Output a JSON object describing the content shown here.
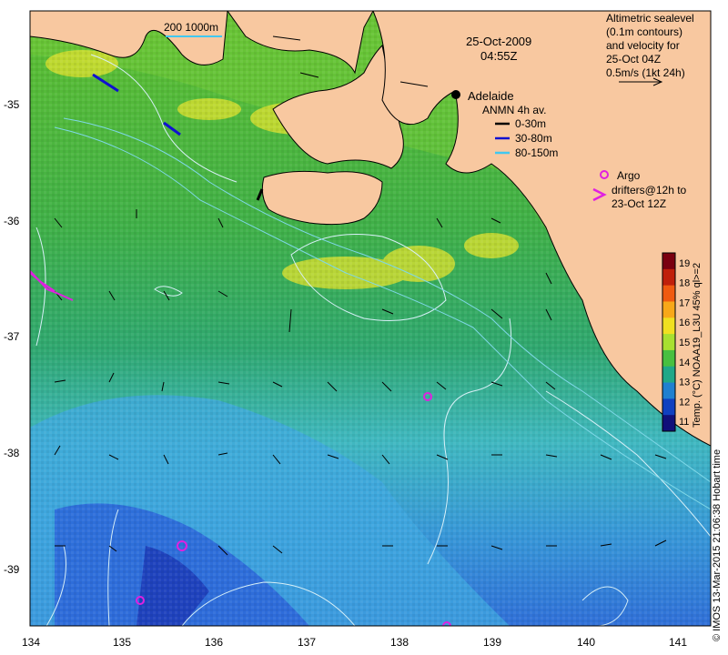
{
  "date_text": "25-Oct-2009",
  "time_text": "04:55Z",
  "scale_bar_label": "200  1000m",
  "city_label": "Adelaide",
  "altimetry_note": [
    "Altimetric sealevel",
    "(0.1m contours)",
    "and velocity for",
    "25-Oct 04Z",
    "0.5m/s (1kt 24h)"
  ],
  "anmn_legend": {
    "title": "ANMN 4h av.",
    "items": [
      {
        "label": "0-30m",
        "color": "#000000"
      },
      {
        "label": "30-80m",
        "color": "#1010d0"
      },
      {
        "label": "80-150m",
        "color": "#40c8f0"
      }
    ]
  },
  "argo_legend": {
    "label": "Argo",
    "marker_color": "#e020e0"
  },
  "drifter_legend": {
    "lines": [
      "drifters@12h to",
      "23-Oct 12Z"
    ],
    "marker_color": "#e020e0"
  },
  "colorbar": {
    "ticks": [
      "19",
      "18",
      "17",
      "16",
      "15",
      "14",
      "13",
      "12",
      "11"
    ],
    "title": "Temp. (°C) NOAA19_L3U 45% ql>=2",
    "colors": [
      "#7a0010",
      "#c0200a",
      "#f05a10",
      "#f8a818",
      "#f0e020",
      "#a8e030",
      "#48c040",
      "#20a888",
      "#2080d0",
      "#1040c0",
      "#10107a"
    ]
  },
  "credit": "© IMOS 13-Mar-2015 21:06:38 Hobart time",
  "axes": {
    "lon_ticks": [
      "134",
      "135",
      "136",
      "137",
      "138",
      "139",
      "140",
      "141"
    ],
    "lat_ticks": [
      "-35",
      "-36",
      "-37",
      "-38",
      "-39"
    ]
  },
  "colors": {
    "land": "#f8c8a0",
    "sst_warm_shelf": "#70c030",
    "sst_mid": "#40b060",
    "sst_cool": "#40b0d0",
    "sst_cold": "#2050d0",
    "contour": "#d0e8f0"
  }
}
